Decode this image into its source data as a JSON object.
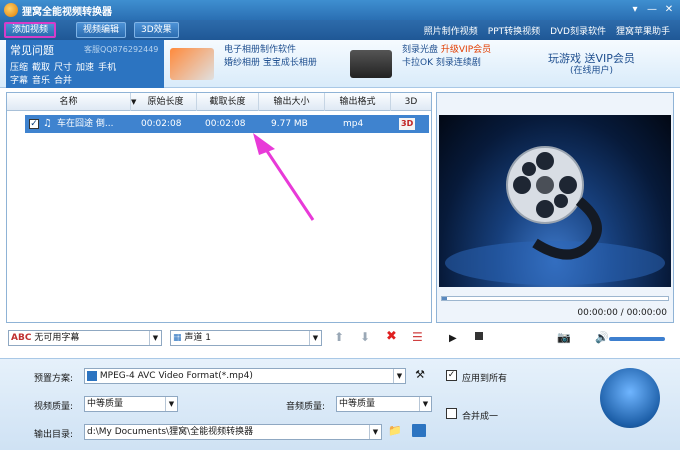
{
  "window": {
    "title": "狸窝全能视频转换器"
  },
  "toolbar": {
    "buttons": [
      {
        "label": "添加视频",
        "active": true
      },
      {
        "label": "视频编辑"
      },
      {
        "label": "3D效果"
      }
    ],
    "links": [
      "照片制作视频",
      "PPT转换视频",
      "DVD刻录软件",
      "狸窝苹果助手"
    ]
  },
  "faq": {
    "title": "常见问题",
    "qq": "客服QQ876292449",
    "rows": [
      [
        "压缩",
        "截取",
        "尺寸",
        "加速",
        "手机"
      ],
      [
        "字幕",
        "音乐",
        "合并"
      ]
    ]
  },
  "promos": [
    {
      "line1": "电子相册制作软件",
      "line2": "婚纱相册  宝宝成长相册"
    },
    {
      "line1": "刻录光盘",
      "line1b": "升级VIP会员",
      "line2": "卡拉OK  刻录连续剧"
    },
    {
      "line1": "玩游戏  送VIP会员",
      "line2": "(在线用户)"
    }
  ],
  "table": {
    "columns": [
      "名称",
      "原始长度",
      "截取长度",
      "输出大小",
      "输出格式",
      "3D"
    ],
    "rows": [
      {
        "name": "车在囧途 倒...",
        "orig_len": "00:02:08",
        "cut_len": "00:02:08",
        "size": "9.77 MB",
        "format": "mp4",
        "td": "3D",
        "checked": true
      }
    ]
  },
  "preview": {
    "time": "00:00:00 / 00:00:00",
    "progress": 0.02
  },
  "lower": {
    "subtitle": "无可用字幕",
    "audio": "声道 1"
  },
  "settings": {
    "preset_label": "预置方案:",
    "preset_value": "MPEG-4 AVC Video Format(*.mp4)",
    "apply_all": "应用到所有",
    "video_quality_label": "视频质量:",
    "video_quality": "中等质量",
    "audio_quality_label": "音频质量:",
    "audio_quality": "中等质量",
    "merge": "合并成一",
    "output_label": "输出目录:",
    "output_path": "d:\\My Documents\\狸窝\\全能视频转换器"
  },
  "colors": {
    "accent": "#2c74c1",
    "highlight_row": "#3f83cf",
    "annotation": "#e83ad8"
  }
}
